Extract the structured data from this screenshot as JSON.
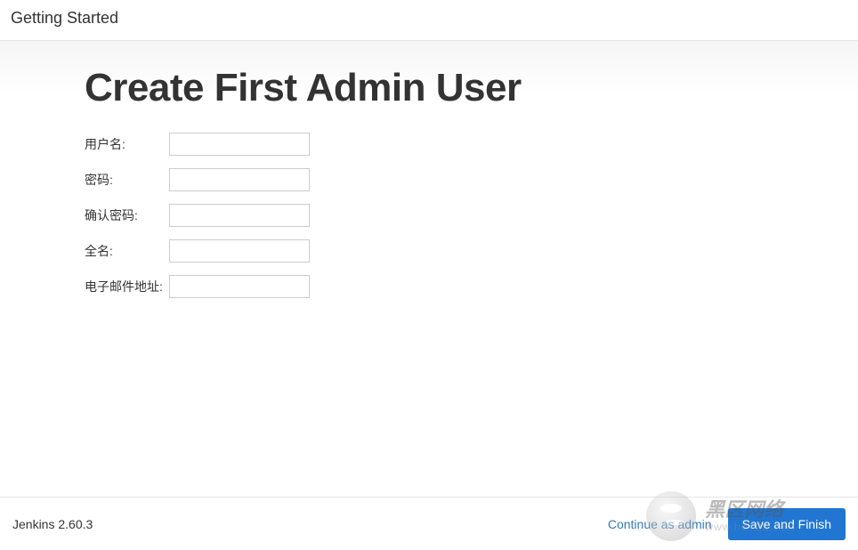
{
  "header": {
    "title": "Getting Started"
  },
  "main": {
    "heading": "Create First Admin User",
    "fields": {
      "username": {
        "label": "用户名:",
        "value": ""
      },
      "password": {
        "label": "密码:",
        "value": ""
      },
      "confirm_password": {
        "label": "确认密码:",
        "value": ""
      },
      "fullname": {
        "label": "全名:",
        "value": ""
      },
      "email": {
        "label": "电子邮件地址:",
        "value": ""
      }
    }
  },
  "footer": {
    "version": "Jenkins 2.60.3",
    "continue_link": "Continue as admin",
    "save_button": "Save and Finish"
  },
  "watermark": {
    "main": "黑区网络",
    "sub": "www.heTqu.com"
  }
}
